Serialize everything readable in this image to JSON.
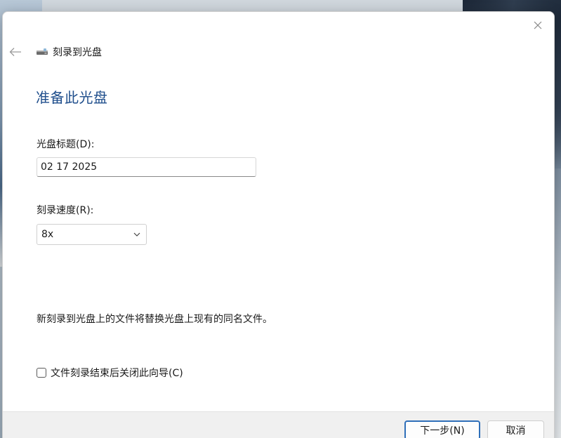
{
  "window": {
    "title": "刻录到光盘",
    "title_icon": "optical-drive-icon",
    "back_icon": "back-arrow-icon",
    "close_icon": "close-icon"
  },
  "page": {
    "heading": "准备此光盘",
    "disc_title_label": "光盘标题(D):",
    "disc_title_value": "02 17 2025",
    "speed_label": "刻录速度(R):",
    "speed_value": "8x",
    "notice": "新刻录到光盘上的文件将替换光盘上现有的同名文件。",
    "close_wizard_checkbox": {
      "label": "文件刻录结束后关闭此向导(C)",
      "checked": false
    }
  },
  "footer": {
    "next_label": "下一步(N)",
    "cancel_label": "取消"
  },
  "colors": {
    "heading": "#1f4e8c",
    "primary_button_border": "#2f6fb9",
    "footer_bg": "#f0f0f0"
  }
}
